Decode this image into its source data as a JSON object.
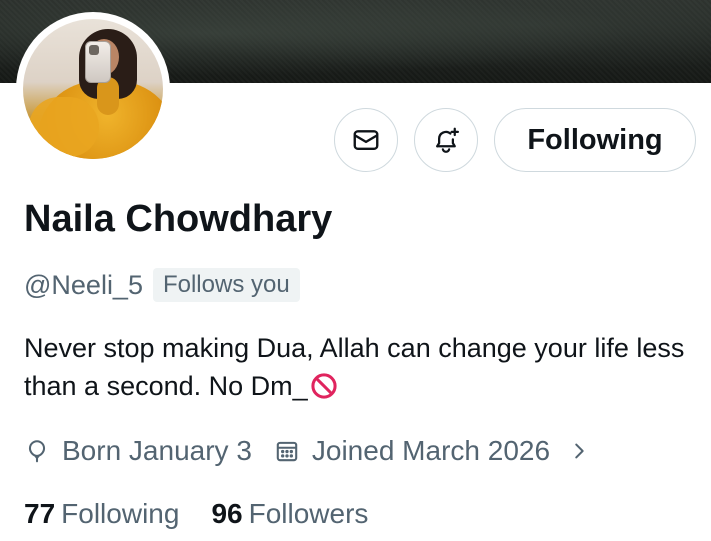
{
  "profile": {
    "name": "Naila Chowdhary",
    "handle": "@Neeli_5",
    "follows_you": "Follows you",
    "bio_text": "Never stop making Dua, Allah can change your life less than a second.  No Dm_",
    "bio_emoji": "no-entry-emoji"
  },
  "actions": {
    "message_icon": "envelope-icon",
    "notify_icon": "bell-plus-icon",
    "follow_label": "Following"
  },
  "meta": {
    "birthday": "Born January 3",
    "birthday_icon": "balloon-icon",
    "joined": "Joined March 2026",
    "joined_icon": "calendar-icon"
  },
  "stats": {
    "following_count": "77",
    "following_label": "Following",
    "followers_count": "96",
    "followers_label": "Followers"
  },
  "colors": {
    "text_primary": "#0f1419",
    "text_secondary": "#536471",
    "border": "#cfd9de",
    "badge_bg": "#eff3f4"
  }
}
